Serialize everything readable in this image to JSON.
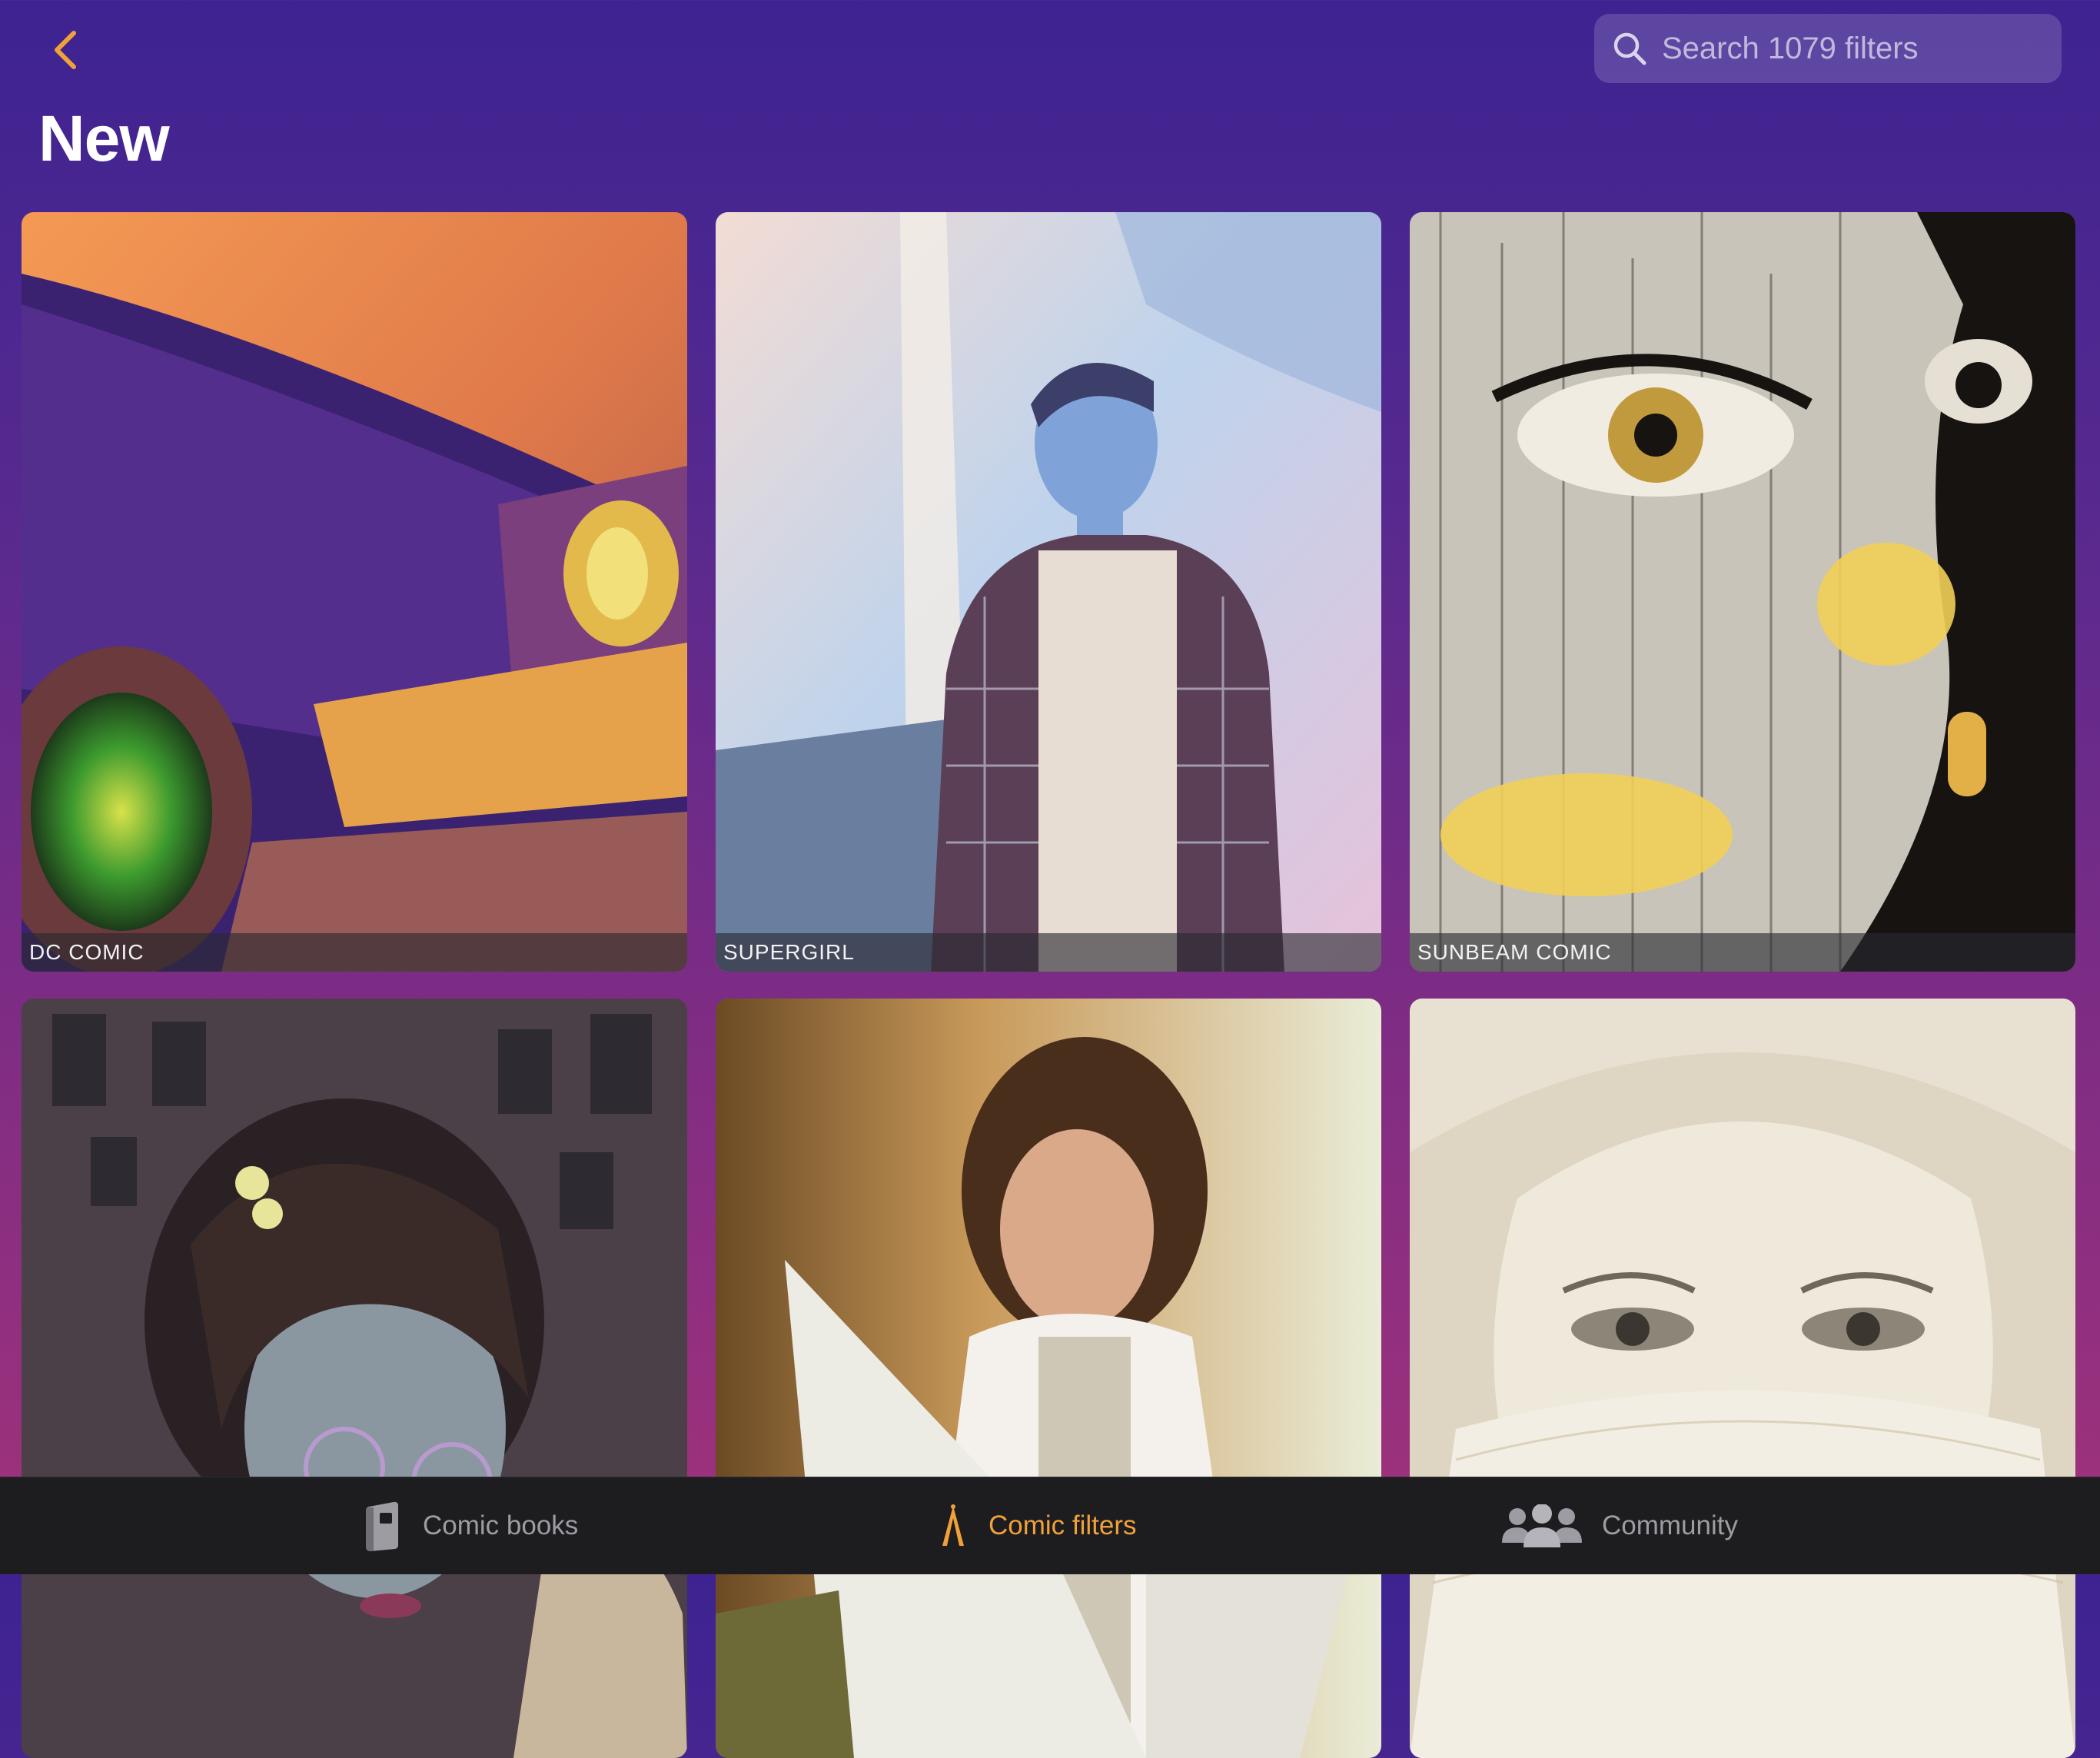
{
  "header": {
    "back_icon": "chevron-left-icon",
    "title": "New",
    "search": {
      "placeholder": "Search 1079 filters",
      "value": ""
    }
  },
  "filters": [
    {
      "label": "DC COMIC"
    },
    {
      "label": "SUPERGIRL"
    },
    {
      "label": "SUNBEAM COMIC"
    },
    {
      "label": ""
    },
    {
      "label": ""
    },
    {
      "label": ""
    }
  ],
  "tabbar": {
    "tabs": [
      {
        "label": "Comic books",
        "icon": "book-icon",
        "active": false
      },
      {
        "label": "Comic filters",
        "icon": "pen-nib-icon",
        "active": true
      },
      {
        "label": "Community",
        "icon": "people-icon",
        "active": false
      }
    ]
  },
  "colors": {
    "accent": "#f0a13a",
    "tab_inactive": "#9c9ca2",
    "tabbar_bg": "#1d1c1f",
    "background_top": "#3d2391",
    "background_bottom": "#a2327a"
  }
}
